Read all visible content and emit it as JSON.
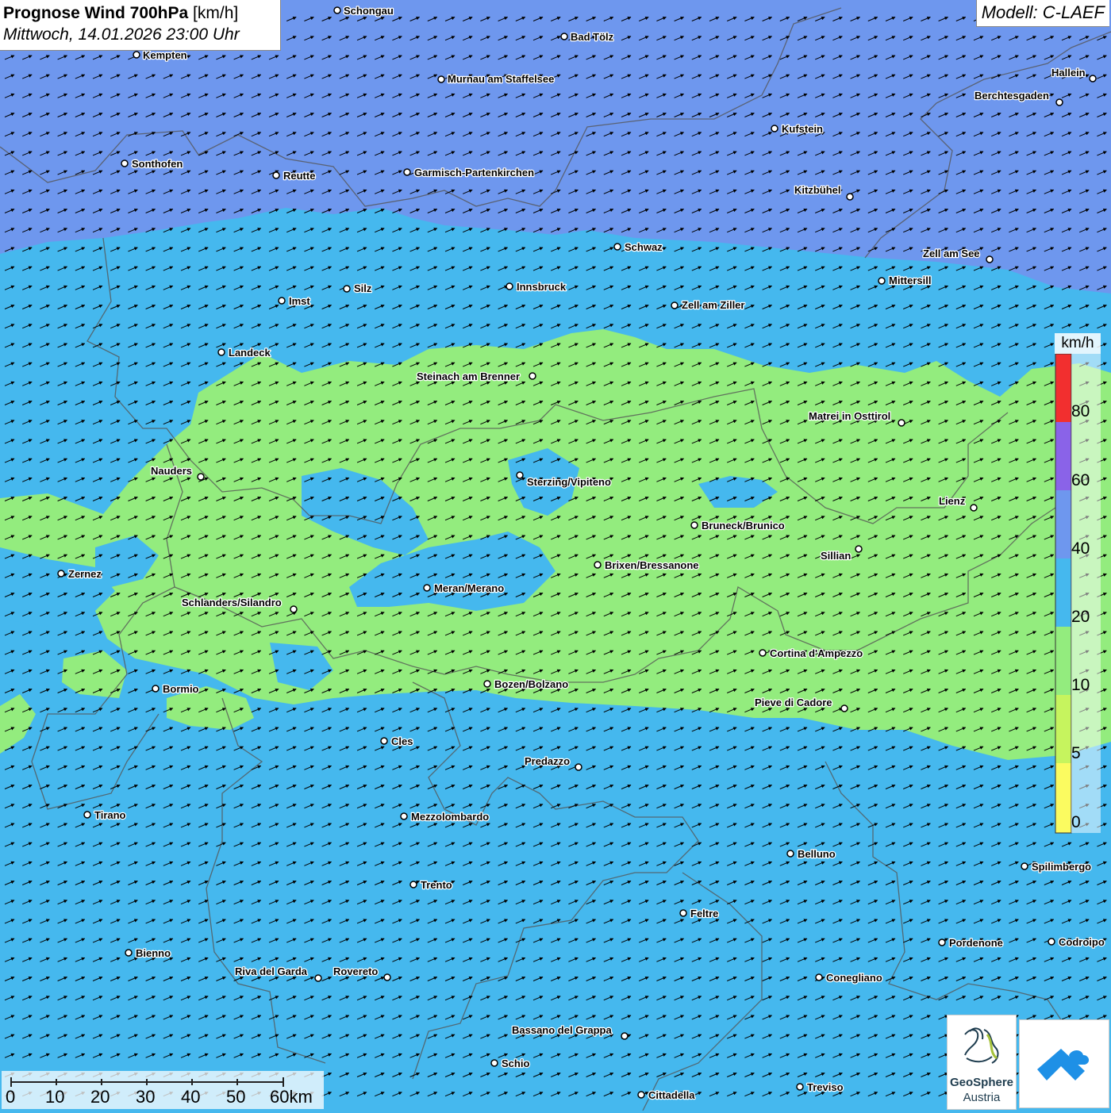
{
  "title": {
    "bold": "Prognose Wind 700hPa",
    "unit": " [km/h]",
    "datetime": "Mittwoch, 14.01.2026 23:00 Uhr"
  },
  "model_label": "Modell: C-LAEF",
  "colors": {
    "band_0_5": "#fbfb60",
    "band_5_10": "#c6f45e",
    "band_10_20": "#93ec7e",
    "band_20_40": "#45b8ee",
    "band_40_60": "#6e97ee",
    "band_60_80": "#8a63e8",
    "band_80_plus": "#f22f2f",
    "borders": "#555555",
    "arrows": "#000000"
  },
  "legend": {
    "unit": "km/h",
    "labels": [
      "80",
      "60",
      "40",
      "20",
      "10",
      "5",
      "0"
    ]
  },
  "wind_direction": "southwest-to-northeast",
  "cities": [
    {
      "name": "Schongau"
    },
    {
      "name": "Bad Tölz"
    },
    {
      "name": "Kempten"
    },
    {
      "name": "Murnau am Staffelsee"
    },
    {
      "name": "Hallein"
    },
    {
      "name": "Berchtesgaden"
    },
    {
      "name": "Kufstein"
    },
    {
      "name": "Sonthofen"
    },
    {
      "name": "Reutte"
    },
    {
      "name": "Garmisch-Partenkirchen"
    },
    {
      "name": "Kitzbühel"
    },
    {
      "name": "Schwaz"
    },
    {
      "name": "Zell am See"
    },
    {
      "name": "Mittersill"
    },
    {
      "name": "Silz"
    },
    {
      "name": "Innsbruck"
    },
    {
      "name": "Imst"
    },
    {
      "name": "Zell am Ziller"
    },
    {
      "name": "Landeck"
    },
    {
      "name": "Steinach am Brenner"
    },
    {
      "name": "Matrei in Osttirol"
    },
    {
      "name": "Nauders"
    },
    {
      "name": "Sterzing/Vipiteno"
    },
    {
      "name": "Lienz"
    },
    {
      "name": "Bruneck/Brunico"
    },
    {
      "name": "Sillian"
    },
    {
      "name": "Zernez"
    },
    {
      "name": "Brixen/Bressanone"
    },
    {
      "name": "Meran/Merano"
    },
    {
      "name": "Schlanders/Silandro"
    },
    {
      "name": "Cortina d'Ampezzo"
    },
    {
      "name": "Bozen/Bolzano"
    },
    {
      "name": "Bormio"
    },
    {
      "name": "Pieve di Cadore"
    },
    {
      "name": "Cles"
    },
    {
      "name": "Predazzo"
    },
    {
      "name": "Tirano"
    },
    {
      "name": "Mezzolombardo"
    },
    {
      "name": "Belluno"
    },
    {
      "name": "Spilimbergo"
    },
    {
      "name": "Trento"
    },
    {
      "name": "Feltre"
    },
    {
      "name": "Pordenone"
    },
    {
      "name": "Codroipo"
    },
    {
      "name": "Bienno"
    },
    {
      "name": "Riva del Garda"
    },
    {
      "name": "Rovereto"
    },
    {
      "name": "Conegliano"
    },
    {
      "name": "Bassano del Grappa"
    },
    {
      "name": "Schio"
    },
    {
      "name": "Treviso"
    },
    {
      "name": "Cittadella"
    }
  ],
  "scalebar": {
    "labels": [
      "0",
      "10",
      "20",
      "30",
      "40",
      "50",
      "60km"
    ]
  },
  "logo": {
    "line1": "GeoSphere",
    "line2": "Austria"
  }
}
